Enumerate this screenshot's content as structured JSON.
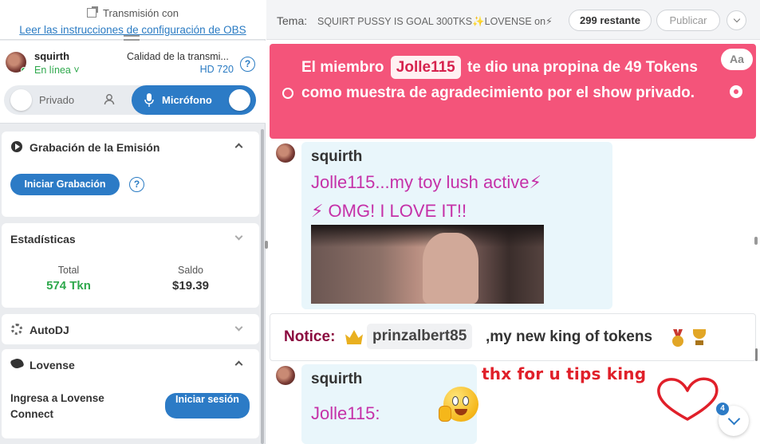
{
  "obs": {
    "title": "Transmisión con",
    "link": "Leer las instrucciones de configuración de OBS"
  },
  "user": {
    "name": "squirth",
    "status": "En línea ˅",
    "quality_label": "Calidad de la transmi...",
    "quality_value": "HD 720",
    "help": "?"
  },
  "mode_toggle": {
    "private_label": "Privado",
    "mic_label": "Micrófono"
  },
  "recording": {
    "title": "Grabación de la Emisión",
    "button": "Iniciar Grabación",
    "help": "?"
  },
  "stats": {
    "title": "Estadísticas",
    "total_label": "Total",
    "total_value": "574 Tkn",
    "balance_label": "Saldo",
    "balance_value": "$19.39",
    "total_color": "#2ea84c"
  },
  "autodj": {
    "title": "AutoDJ"
  },
  "lovense": {
    "title": "Lovense",
    "connect_text": "Ingresa a Lovense Connect",
    "button": "Iniciar sesión"
  },
  "topic": {
    "label": "Tema:",
    "text": "SQUIRT PUSSY IS GOAL 300TKS✨LOVENSE on⚡",
    "remaining": "299 restante",
    "publish": "Publicar"
  },
  "chat": {
    "tip": {
      "prefix": "El miembro",
      "user": "Jolle115",
      "suffix": "te dio una propina de 49 Tokens como muestra de agradecimiento por el show privado.",
      "font_button": "Aa",
      "color": "#f4547a"
    },
    "message1": {
      "author": "squirth",
      "line1": "Jolle115...my toy lush active⚡",
      "line2": "⚡ OMG! I LOVE IT!!"
    },
    "notice": {
      "label": "Notice:",
      "user": "prinzalbert85",
      "text": ",my new king of tokens"
    },
    "message2": {
      "author": "squirth",
      "body": "Jolle115:"
    },
    "overlay_text": "thx for u tips king",
    "unread_count": "4"
  }
}
